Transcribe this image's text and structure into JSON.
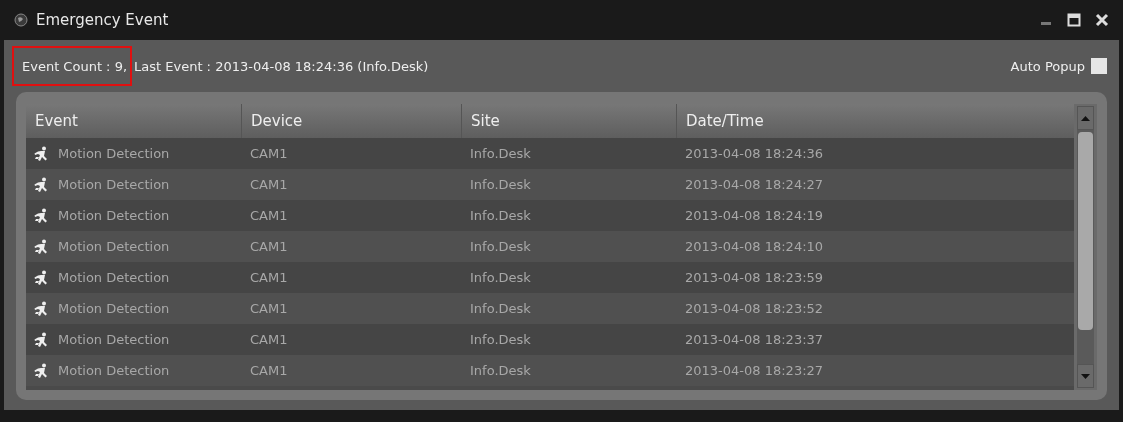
{
  "window": {
    "title": "Emergency Event"
  },
  "info": {
    "event_count": "Event Count : 9,",
    "event_count_highlighted": true,
    "last_event": "Last Event : 2013-04-08 18:24:36 (Info.Desk)"
  },
  "auto_popup": {
    "label": "Auto Popup",
    "checked": false
  },
  "table": {
    "columns": [
      "Event",
      "Device",
      "Site",
      "Date/Time"
    ],
    "rows": [
      {
        "event": "Motion Detection",
        "device": "CAM1",
        "site": "Info.Desk",
        "datetime": "2013-04-08 18:24:36"
      },
      {
        "event": "Motion Detection",
        "device": "CAM1",
        "site": "Info.Desk",
        "datetime": "2013-04-08 18:24:27"
      },
      {
        "event": "Motion Detection",
        "device": "CAM1",
        "site": "Info.Desk",
        "datetime": "2013-04-08 18:24:19"
      },
      {
        "event": "Motion Detection",
        "device": "CAM1",
        "site": "Info.Desk",
        "datetime": "2013-04-08 18:24:10"
      },
      {
        "event": "Motion Detection",
        "device": "CAM1",
        "site": "Info.Desk",
        "datetime": "2013-04-08 18:23:59"
      },
      {
        "event": "Motion Detection",
        "device": "CAM1",
        "site": "Info.Desk",
        "datetime": "2013-04-08 18:23:52"
      },
      {
        "event": "Motion Detection",
        "device": "CAM1",
        "site": "Info.Desk",
        "datetime": "2013-04-08 18:23:37"
      },
      {
        "event": "Motion Detection",
        "device": "CAM1",
        "site": "Info.Desk",
        "datetime": "2013-04-08 18:23:27"
      }
    ]
  }
}
